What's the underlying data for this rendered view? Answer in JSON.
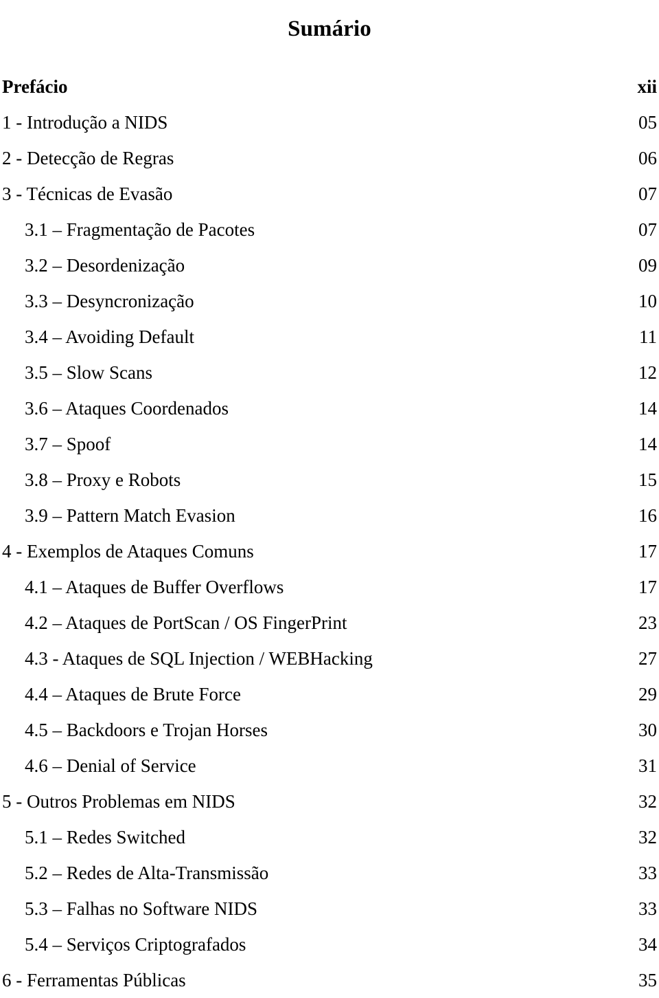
{
  "document": {
    "title": "Sumário"
  },
  "toc": {
    "entries": [
      {
        "label": "Prefácio",
        "page": "xii",
        "level": 1,
        "bold": true
      },
      {
        "label": "1 - Introdução a NIDS",
        "page": "05",
        "level": 1,
        "bold": false
      },
      {
        "label": "2 - Detecção de Regras",
        "page": "06",
        "level": 1,
        "bold": false
      },
      {
        "label": "3 - Técnicas de Evasão",
        "page": "07",
        "level": 1,
        "bold": false
      },
      {
        "label": "3.1 – Fragmentação de Pacotes",
        "page": "07",
        "level": 2,
        "bold": false
      },
      {
        "label": "3.2 – Desordenização",
        "page": "09",
        "level": 2,
        "bold": false
      },
      {
        "label": "3.3 – Desyncronização",
        "page": "10",
        "level": 2,
        "bold": false
      },
      {
        "label": "3.4 – Avoiding Default",
        "page": "11",
        "level": 2,
        "bold": false
      },
      {
        "label": "3.5 – Slow Scans",
        "page": "12",
        "level": 2,
        "bold": false
      },
      {
        "label": "3.6 – Ataques Coordenados",
        "page": "14",
        "level": 2,
        "bold": false
      },
      {
        "label": "3.7 – Spoof",
        "page": "14",
        "level": 2,
        "bold": false
      },
      {
        "label": "3.8 – Proxy e Robots",
        "page": "15",
        "level": 2,
        "bold": false
      },
      {
        "label": "3.9 – Pattern Match Evasion",
        "page": "16",
        "level": 2,
        "bold": false
      },
      {
        "label": "4 - Exemplos de Ataques Comuns",
        "page": "17",
        "level": 1,
        "bold": false
      },
      {
        "label": "4.1 – Ataques de Buffer Overflows",
        "page": "17",
        "level": 2,
        "bold": false
      },
      {
        "label": "4.2 – Ataques de PortScan / OS FingerPrint",
        "page": "23",
        "level": 2,
        "bold": false
      },
      {
        "label": "4.3 - Ataques de SQL Injection / WEBHacking",
        "page": "27",
        "level": 2,
        "bold": false
      },
      {
        "label": "4.4 – Ataques de Brute Force",
        "page": "29",
        "level": 2,
        "bold": false
      },
      {
        "label": "4.5 – Backdoors e Trojan Horses",
        "page": "30",
        "level": 2,
        "bold": false
      },
      {
        "label": "4.6 – Denial of Service",
        "page": "31",
        "level": 2,
        "bold": false
      },
      {
        "label": "5 - Outros Problemas em NIDS",
        "page": "32",
        "level": 1,
        "bold": false
      },
      {
        "label": "5.1 – Redes Switched",
        "page": "32",
        "level": 2,
        "bold": false
      },
      {
        "label": "5.2 – Redes de Alta-Transmissão",
        "page": "33",
        "level": 2,
        "bold": false
      },
      {
        "label": "5.3 – Falhas no Software NIDS",
        "page": "33",
        "level": 2,
        "bold": false
      },
      {
        "label": "5.4 – Serviços Criptografados",
        "page": "34",
        "level": 2,
        "bold": false
      },
      {
        "label": "6 - Ferramentas Públicas",
        "page": "35",
        "level": 1,
        "bold": false
      }
    ]
  }
}
